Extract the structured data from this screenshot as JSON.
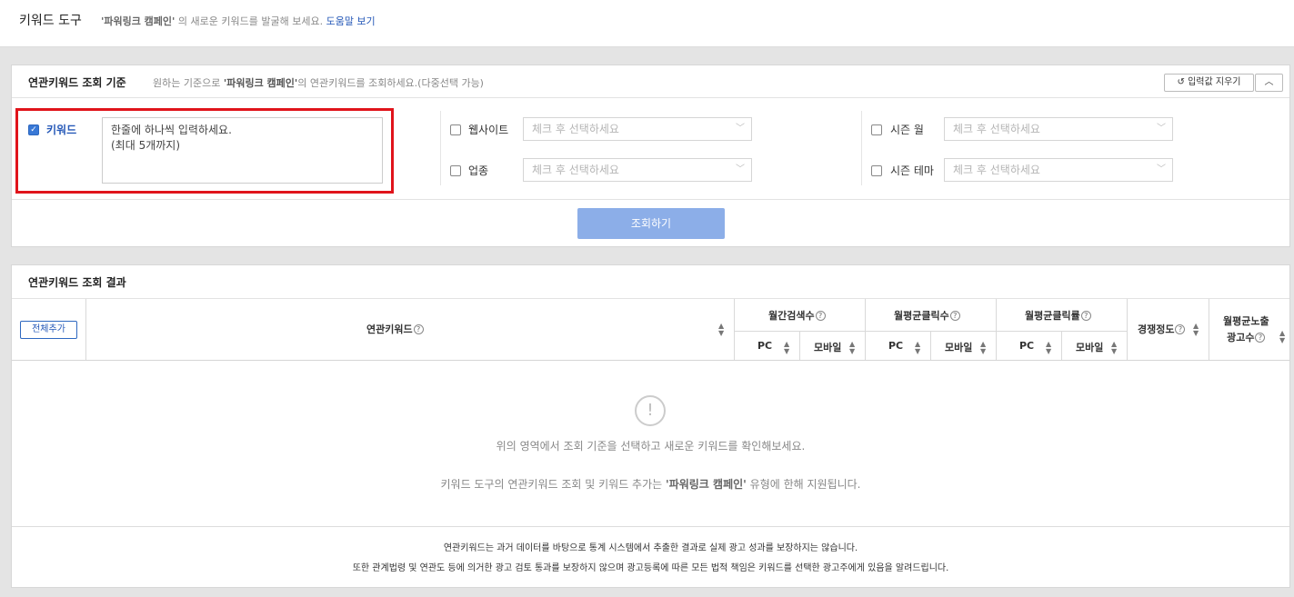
{
  "header": {
    "title": "키워드 도구",
    "campaign": "'파워링크 캠페인'",
    "subtitle": "의 새로운 키워드를 발굴해 보세요.",
    "help": "도움말 보기"
  },
  "criteria": {
    "title": "연관키워드 조회 기준",
    "desc_pre": "원하는 기준으로",
    "desc_campaign": "'파워링크 캠페인'",
    "desc_post": "의 연관키워드를 조회하세요.(다중선택 가능)",
    "reset": "입력값 지우기",
    "keyword_label": "키워드",
    "keyword_placeholder_line1": "한줄에 하나씩 입력하세요.",
    "keyword_placeholder_line2": "(최대 5개까지)",
    "website_label": "웹사이트",
    "industry_label": "업종",
    "season_month_label": "시즌 월",
    "season_theme_label": "시즌 테마",
    "select_placeholder": "체크 후 선택하세요",
    "search_button": "조회하기"
  },
  "results": {
    "title": "연관키워드 조회 결과",
    "add_all": "전체추가",
    "col_keyword": "연관키워드",
    "col_monthly_search": "월간검색수",
    "col_avg_clicks": "월평균클릭수",
    "col_avg_ctr": "월평균클릭률",
    "col_competition": "경쟁정도",
    "col_ad_count_line1": "월평균노출",
    "col_ad_count_line2": "광고수",
    "sub_pc": "PC",
    "sub_mobile": "모바일",
    "empty_icon": "!",
    "empty_msg1": "위의 영역에서 조회 기준을 선택하고 새로운 키워드를 확인해보세요.",
    "empty_msg2_pre": "키워드 도구의 연관키워드 조회 및 키워드 추가는",
    "empty_msg2_campaign": "'파워링크 캠페인'",
    "empty_msg2_post": "유형에 한해 지원됩니다.",
    "notice1": "연관키워드는 과거 데이터를 바탕으로 통계 시스템에서 추출한 결과로 실제 광고 성과를 보장하지는 않습니다.",
    "notice2": "또한 관계법령 및 연관도 등에 의거한 광고 검토 통과를 보장하지 않으며 광고등록에 따른 모든 법적 책임은 키워드를 선택한 광고주에게 있음을 알려드립니다."
  }
}
